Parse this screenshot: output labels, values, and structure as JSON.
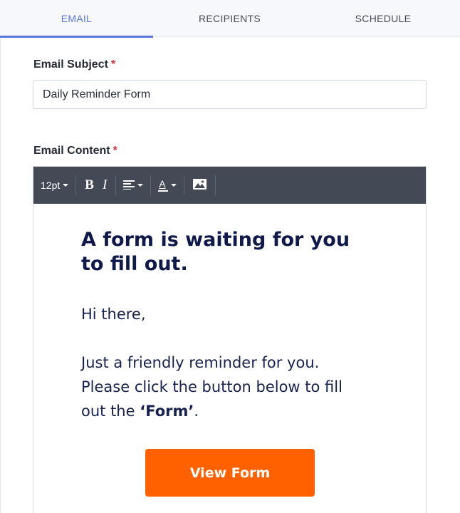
{
  "tabs": [
    {
      "label": "EMAIL",
      "active": true
    },
    {
      "label": "RECIPIENTS",
      "active": false
    },
    {
      "label": "SCHEDULE",
      "active": false
    }
  ],
  "subject": {
    "label": "Email Subject",
    "required_mark": "*",
    "value": "Daily Reminder Form"
  },
  "content_field": {
    "label": "Email Content",
    "required_mark": "*"
  },
  "toolbar": {
    "font_size": "12pt",
    "bold": "B",
    "italic": "I",
    "align_icon": "align-left-icon",
    "text_color": "A",
    "image_icon": "image-icon"
  },
  "email_body": {
    "heading": "A form is waiting for you to fill out.",
    "greeting": "Hi there,",
    "message_part1": "Just a friendly reminder for you. Please click the button below to fill out the ",
    "message_bold": "‘Form’",
    "message_end": ".",
    "button_label": "View Form"
  },
  "colors": {
    "accent": "#5b78d6",
    "toolbar_bg": "#434955",
    "button_bg": "#ff6100",
    "heading_text": "#101a4a",
    "required": "#d6303a"
  }
}
